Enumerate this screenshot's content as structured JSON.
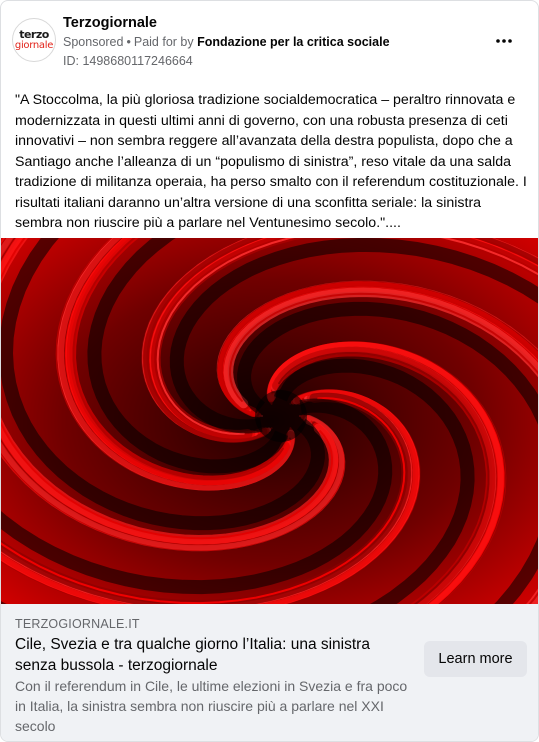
{
  "post": {
    "page_name": "Terzogiornale",
    "avatar": {
      "line1": "terzo",
      "line2": "giornale"
    },
    "sponsored_label": "Sponsored",
    "paid_for_prefix": "Paid for by",
    "sponsor": "Fondazione per la critica sociale",
    "ad_id": "ID: 1498680117246664",
    "more_icon": "ellipsis-icon",
    "body": "\"A Stoccolma, la più gloriosa tradizione socialdemocratica – peraltro rinnovata e modernizzata in questi ultimi anni di governo, con una robusta presenza di ceti innovativi – non sembra reggere all’avanzata della destra populista, dopo che a Santiago anche l’alleanza di un “populismo di sinistra”, reso vitale da una salda tradizione di militanza operaia, ha perso smalto con il referendum costituzionale. I risultati italiani daranno un’altra versione di una sconfitta seriale: la sinistra sembra non riuscire più a parlare nel Ventunesimo secolo.\"...."
  },
  "link": {
    "domain": "TERZOGIORNALE.IT",
    "headline": "Cile, Svezia e tra qualche giorno l’Italia: una sinistra senza bussola - terzogiornale",
    "description": "Con il referendum in Cile, le ultime elezioni in Svezia e fra poco in Italia, la sinistra sembra non riuscire più a parlare nel XXI secolo",
    "cta_label": "Learn more"
  },
  "colors": {
    "hero_red": "#e00000",
    "hero_dark": "#000000",
    "button_bg": "#e4e6eb",
    "footer_bg": "#f0f2f5",
    "secondary_text": "#65676b"
  }
}
